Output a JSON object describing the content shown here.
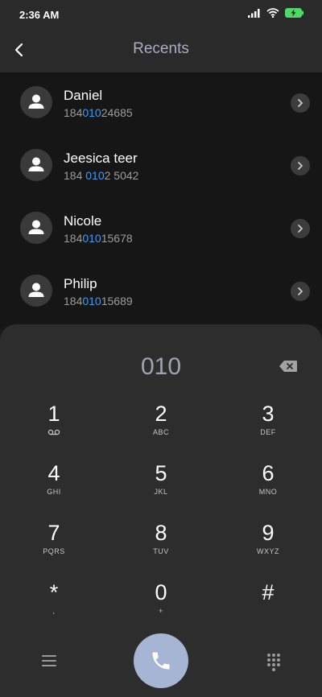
{
  "status": {
    "time": "2:36 AM"
  },
  "header": {
    "title": "Recents"
  },
  "contacts": [
    {
      "name": "Daniel",
      "number_prefix": "184",
      "number_match": "010",
      "number_suffix": "24685"
    },
    {
      "name": "Jeesica teer",
      "number_prefix": "184 ",
      "number_match": "010",
      "number_suffix": "2 5042"
    },
    {
      "name": "Nicole",
      "number_prefix": "184",
      "number_match": "010",
      "number_suffix": "15678"
    },
    {
      "name": "Philip",
      "number_prefix": "184",
      "number_match": "010",
      "number_suffix": "15689"
    }
  ],
  "dialpad": {
    "input": "010",
    "keys": [
      {
        "digit": "1",
        "letters": ""
      },
      {
        "digit": "2",
        "letters": "ABC"
      },
      {
        "digit": "3",
        "letters": "DEF"
      },
      {
        "digit": "4",
        "letters": "GHI"
      },
      {
        "digit": "5",
        "letters": "JKL"
      },
      {
        "digit": "6",
        "letters": "MNO"
      },
      {
        "digit": "7",
        "letters": "PQRS"
      },
      {
        "digit": "8",
        "letters": "TUV"
      },
      {
        "digit": "9",
        "letters": "WXYZ"
      },
      {
        "digit": "*",
        "letters": ","
      },
      {
        "digit": "0",
        "letters": "+"
      },
      {
        "digit": "#",
        "letters": ""
      }
    ]
  },
  "colors": {
    "highlight": "#3c9bf2",
    "call_button": "#a7b5d5",
    "battery": "#4cd964"
  },
  "icons": [
    "back-arrow-icon",
    "signal-icon",
    "wifi-icon",
    "battery-charging-icon",
    "person-icon",
    "chevron-right-icon",
    "backspace-icon",
    "voicemail-icon",
    "menu-icon",
    "phone-icon",
    "keypad-icon"
  ]
}
